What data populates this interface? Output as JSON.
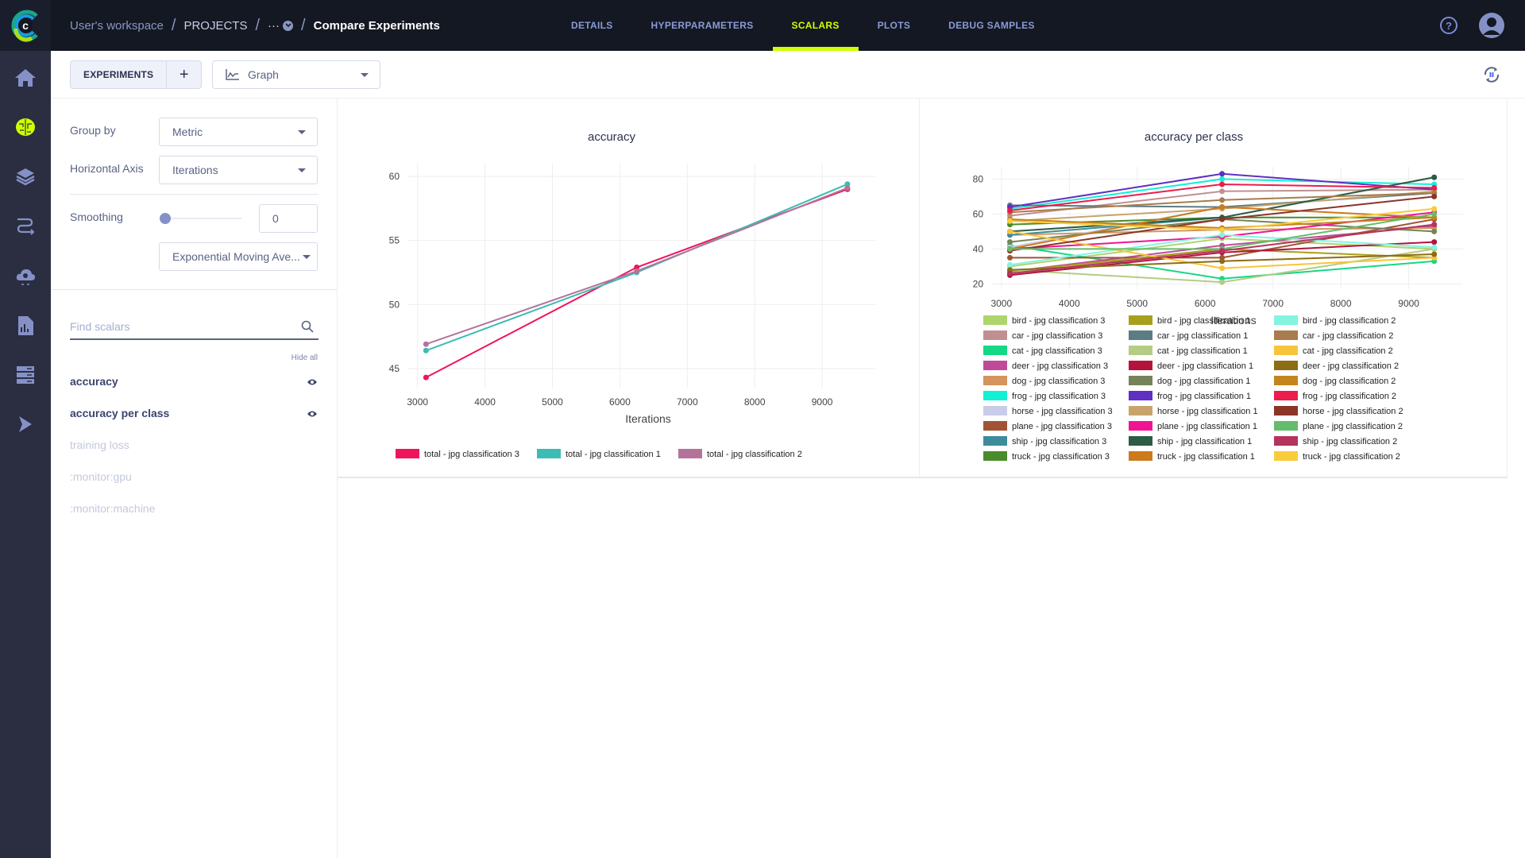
{
  "header": {
    "breadcrumb": {
      "workspace": "User's workspace",
      "projects": "PROJECTS",
      "ellipsis": "···",
      "current": "Compare Experiments"
    },
    "tabs": [
      {
        "label": "DETAILS",
        "active": false
      },
      {
        "label": "HYPERPARAMETERS",
        "active": false
      },
      {
        "label": "SCALARS",
        "active": true
      },
      {
        "label": "PLOTS",
        "active": false
      },
      {
        "label": "DEBUG SAMPLES",
        "active": false
      }
    ],
    "help_label": "?",
    "accent_color": "#d0ff00"
  },
  "sidebar": {
    "items": [
      {
        "icon": "home-icon",
        "active": false
      },
      {
        "icon": "brain-icon",
        "active": true
      },
      {
        "icon": "layers-icon",
        "active": false
      },
      {
        "icon": "pipelines-icon",
        "active": false
      },
      {
        "icon": "cloud-gear-icon",
        "active": false
      },
      {
        "icon": "report-icon",
        "active": false
      },
      {
        "icon": "server-icon",
        "active": false
      },
      {
        "icon": "forward-icon",
        "active": false
      }
    ]
  },
  "toolbar": {
    "experiments_label": "EXPERIMENTS",
    "add_label": "+",
    "view_select": "Graph"
  },
  "settings": {
    "group_by_label": "Group by",
    "group_by_value": "Metric",
    "horizontal_axis_label": "Horizontal Axis",
    "horizontal_axis_value": "Iterations",
    "smoothing_label": "Smoothing",
    "smoothing_value": "0",
    "smoothing_fraction": 0,
    "smoothing_type": "Exponential Moving Ave..."
  },
  "scalars": {
    "search_placeholder": "Find scalars",
    "hide_all_label": "Hide all",
    "items": [
      {
        "label": "accuracy",
        "visible": true
      },
      {
        "label": "accuracy per class",
        "visible": true
      },
      {
        "label": "training loss",
        "visible": false
      },
      {
        "label": ":monitor:gpu",
        "visible": false
      },
      {
        "label": ":monitor:machine",
        "visible": false
      }
    ]
  },
  "chart_data": [
    {
      "type": "line",
      "title": "accuracy",
      "xlabel": "Iterations",
      "ylabel": "",
      "xlim": [
        2850,
        9800
      ],
      "ylim": [
        43.5,
        61
      ],
      "xticks": [
        3000,
        4000,
        5000,
        6000,
        7000,
        8000,
        9000
      ],
      "yticks": [
        45,
        50,
        55,
        60
      ],
      "grid": true,
      "legend_position": "bottom",
      "x": [
        3125,
        6250,
        9375
      ],
      "series": [
        {
          "name": "total - jpg classification 3",
          "color": "#f0145a",
          "values": [
            44.3,
            52.9,
            59.0
          ]
        },
        {
          "name": "total - jpg classification 1",
          "color": "#3cbcb4",
          "values": [
            46.4,
            52.5,
            59.4
          ]
        },
        {
          "name": "total - jpg classification 2",
          "color": "#b4749a",
          "values": [
            46.9,
            52.6,
            59.1
          ]
        }
      ]
    },
    {
      "type": "line",
      "title": "accuracy per class",
      "xlabel": "Iterations",
      "ylabel": "",
      "xlim": [
        2850,
        9800
      ],
      "ylim": [
        17,
        87
      ],
      "xticks": [
        3000,
        4000,
        5000,
        6000,
        7000,
        8000,
        9000
      ],
      "yticks": [
        20,
        40,
        60,
        80
      ],
      "grid": true,
      "legend_position": "bottom",
      "x": [
        3125,
        6250,
        9375
      ],
      "series": [
        {
          "name": "bird - jpg classification 3",
          "color": "#aed46e",
          "values": [
            30,
            46,
            40
          ]
        },
        {
          "name": "car - jpg classification 3",
          "color": "#c09090",
          "values": [
            59,
            73,
            74
          ]
        },
        {
          "name": "cat - jpg classification 3",
          "color": "#14d884",
          "values": [
            42,
            23,
            33
          ]
        },
        {
          "name": "deer - jpg classification 3",
          "color": "#c04a9a",
          "values": [
            27,
            42,
            53
          ]
        },
        {
          "name": "dog - jpg classification 3",
          "color": "#d4945c",
          "values": [
            48,
            51,
            52
          ]
        },
        {
          "name": "frog - jpg classification 3",
          "color": "#14f0d4",
          "values": [
            63,
            80,
            77
          ]
        },
        {
          "name": "horse - jpg classification 3",
          "color": "#c8cce8",
          "values": [
            41,
            64,
            72
          ]
        },
        {
          "name": "plane - jpg classification 3",
          "color": "#a05434",
          "values": [
            35,
            35,
            57
          ]
        },
        {
          "name": "ship - jpg classification 3",
          "color": "#3c8c9c",
          "values": [
            48,
            58,
            81
          ]
        },
        {
          "name": "truck - jpg classification 3",
          "color": "#4a8c2c",
          "values": [
            54,
            58,
            58
          ]
        },
        {
          "name": "bird - jpg classification 1",
          "color": "#a8a01c",
          "values": [
            27,
            40,
            35
          ]
        },
        {
          "name": "car - jpg classification 1",
          "color": "#5c7c84",
          "values": [
            65,
            64,
            72
          ]
        },
        {
          "name": "cat - jpg classification 1",
          "color": "#b4cc84",
          "values": [
            28,
            21,
            40
          ]
        },
        {
          "name": "deer - jpg classification 1",
          "color": "#b4143c",
          "values": [
            25,
            38,
            44
          ]
        },
        {
          "name": "dog - jpg classification 1",
          "color": "#748458",
          "values": [
            44,
            57,
            50
          ]
        },
        {
          "name": "frog - jpg classification 1",
          "color": "#6030c0",
          "values": [
            64,
            83,
            74
          ]
        },
        {
          "name": "horse - jpg classification 1",
          "color": "#c8a46c",
          "values": [
            56,
            63,
            73
          ]
        },
        {
          "name": "plane - jpg classification 1",
          "color": "#f01494",
          "values": [
            40,
            47,
            61
          ]
        },
        {
          "name": "ship - jpg classification 1",
          "color": "#2c5c44",
          "values": [
            50,
            58,
            81
          ]
        },
        {
          "name": "truck - jpg classification 1",
          "color": "#cc7a1c",
          "values": [
            40,
            64,
            58
          ]
        },
        {
          "name": "bird - jpg classification 2",
          "color": "#84f4e0",
          "values": [
            31,
            48,
            41
          ]
        },
        {
          "name": "car - jpg classification 2",
          "color": "#a87c4c",
          "values": [
            61,
            68,
            72
          ]
        },
        {
          "name": "cat - jpg classification 2",
          "color": "#f8c43c",
          "values": [
            50,
            29,
            35
          ]
        },
        {
          "name": "deer - jpg classification 2",
          "color": "#8c6c14",
          "values": [
            28,
            33,
            37
          ]
        },
        {
          "name": "dog - jpg classification 2",
          "color": "#c4841c",
          "values": [
            57,
            52,
            58
          ]
        },
        {
          "name": "frog - jpg classification 2",
          "color": "#ec1c4c",
          "values": [
            62,
            77,
            75
          ]
        },
        {
          "name": "horse - jpg classification 2",
          "color": "#8c3428",
          "values": [
            39,
            57,
            70
          ]
        },
        {
          "name": "plane - jpg classification 2",
          "color": "#64bc6c",
          "values": [
            40,
            40,
            60
          ]
        },
        {
          "name": "ship - jpg classification 2",
          "color": "#b4345c",
          "values": [
            26,
            39,
            54
          ]
        },
        {
          "name": "truck - jpg classification 2",
          "color": "#f8cc3c",
          "values": [
            56,
            51,
            63
          ]
        }
      ]
    }
  ]
}
